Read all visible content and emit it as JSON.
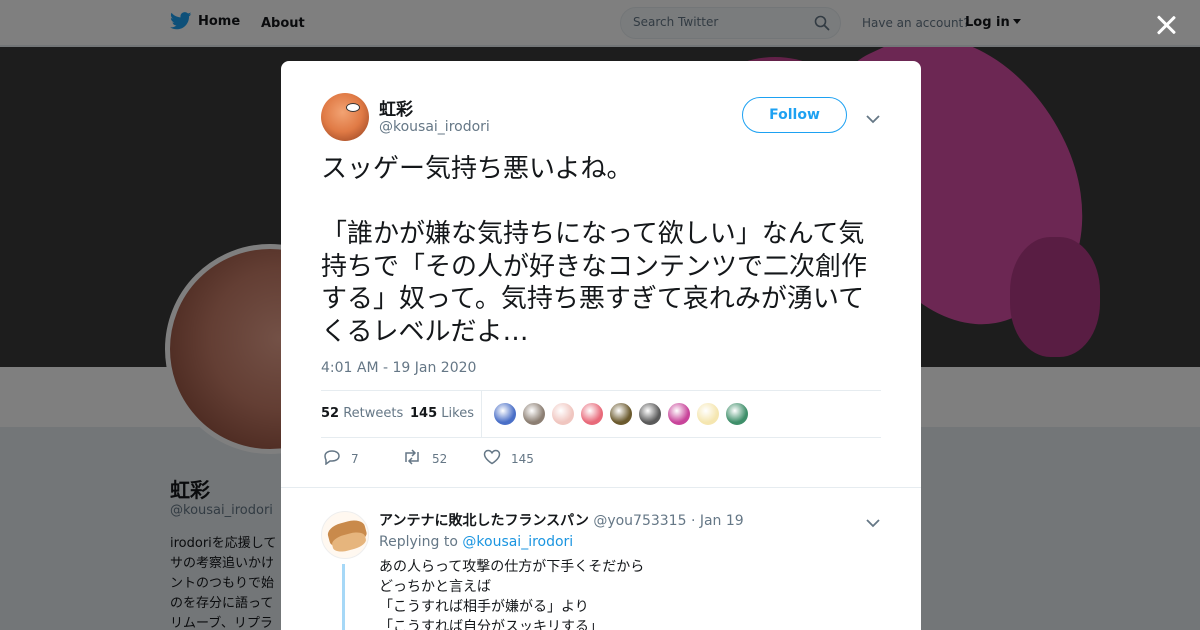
{
  "topbar": {
    "home_label": "Home",
    "about_label": "About",
    "search_placeholder": "Search Twitter",
    "account_question": "Have an account?",
    "login_label": "Log in"
  },
  "profile": {
    "name": "虹彩",
    "handle": "@kousai_irodori",
    "bio_lines": [
      "irodoriを応援して",
      "サの考察追いかけ",
      "ントのつもりで始",
      "のを存分に語って",
      "リムーブ、リプラ"
    ]
  },
  "tweet": {
    "author_name": "虹彩",
    "author_handle": "@kousai_irodori",
    "follow_label": "Follow",
    "text": "スッゲー気持ち悪いよね。\n\n「誰かが嫌な気持ちになって欲しい」なんて気持ちで「その人が好きなコンテンツで二次創作する」奴って。気持ち悪すぎて哀れみが湧いてくるレベルだよ…",
    "timestamp": "4:01 AM - 19 Jan 2020",
    "retweets_count": "52",
    "retweets_label": "Retweets",
    "likes_count": "145",
    "likes_label": "Likes",
    "actions": {
      "reply_count": "7",
      "retweet_count": "52",
      "like_count": "145"
    },
    "liker_colors": [
      "#4a6fc7",
      "#8c7f73",
      "#f0c6c0",
      "#e86a7a",
      "#6b5a2e",
      "#5a5a5a",
      "#c8449a",
      "#f5e6b0",
      "#3f8f6a"
    ]
  },
  "reply": {
    "author_name": "アンテナに敗北したフランスパン",
    "author_handle": "@you753315",
    "separator": "·",
    "date": "Jan 19",
    "replying_prefix": "Replying to",
    "replying_to": "@kousai_irodori",
    "text": "あの人らって攻撃の仕方が下手くそだから\nどっちかと言えば\n「こうすれば相手が嫌がる」より\n「こうすれば自分がスッキリする」"
  },
  "colors": {
    "brand": "#1da1f2",
    "link": "#1b95e0",
    "muted": "#657786"
  }
}
